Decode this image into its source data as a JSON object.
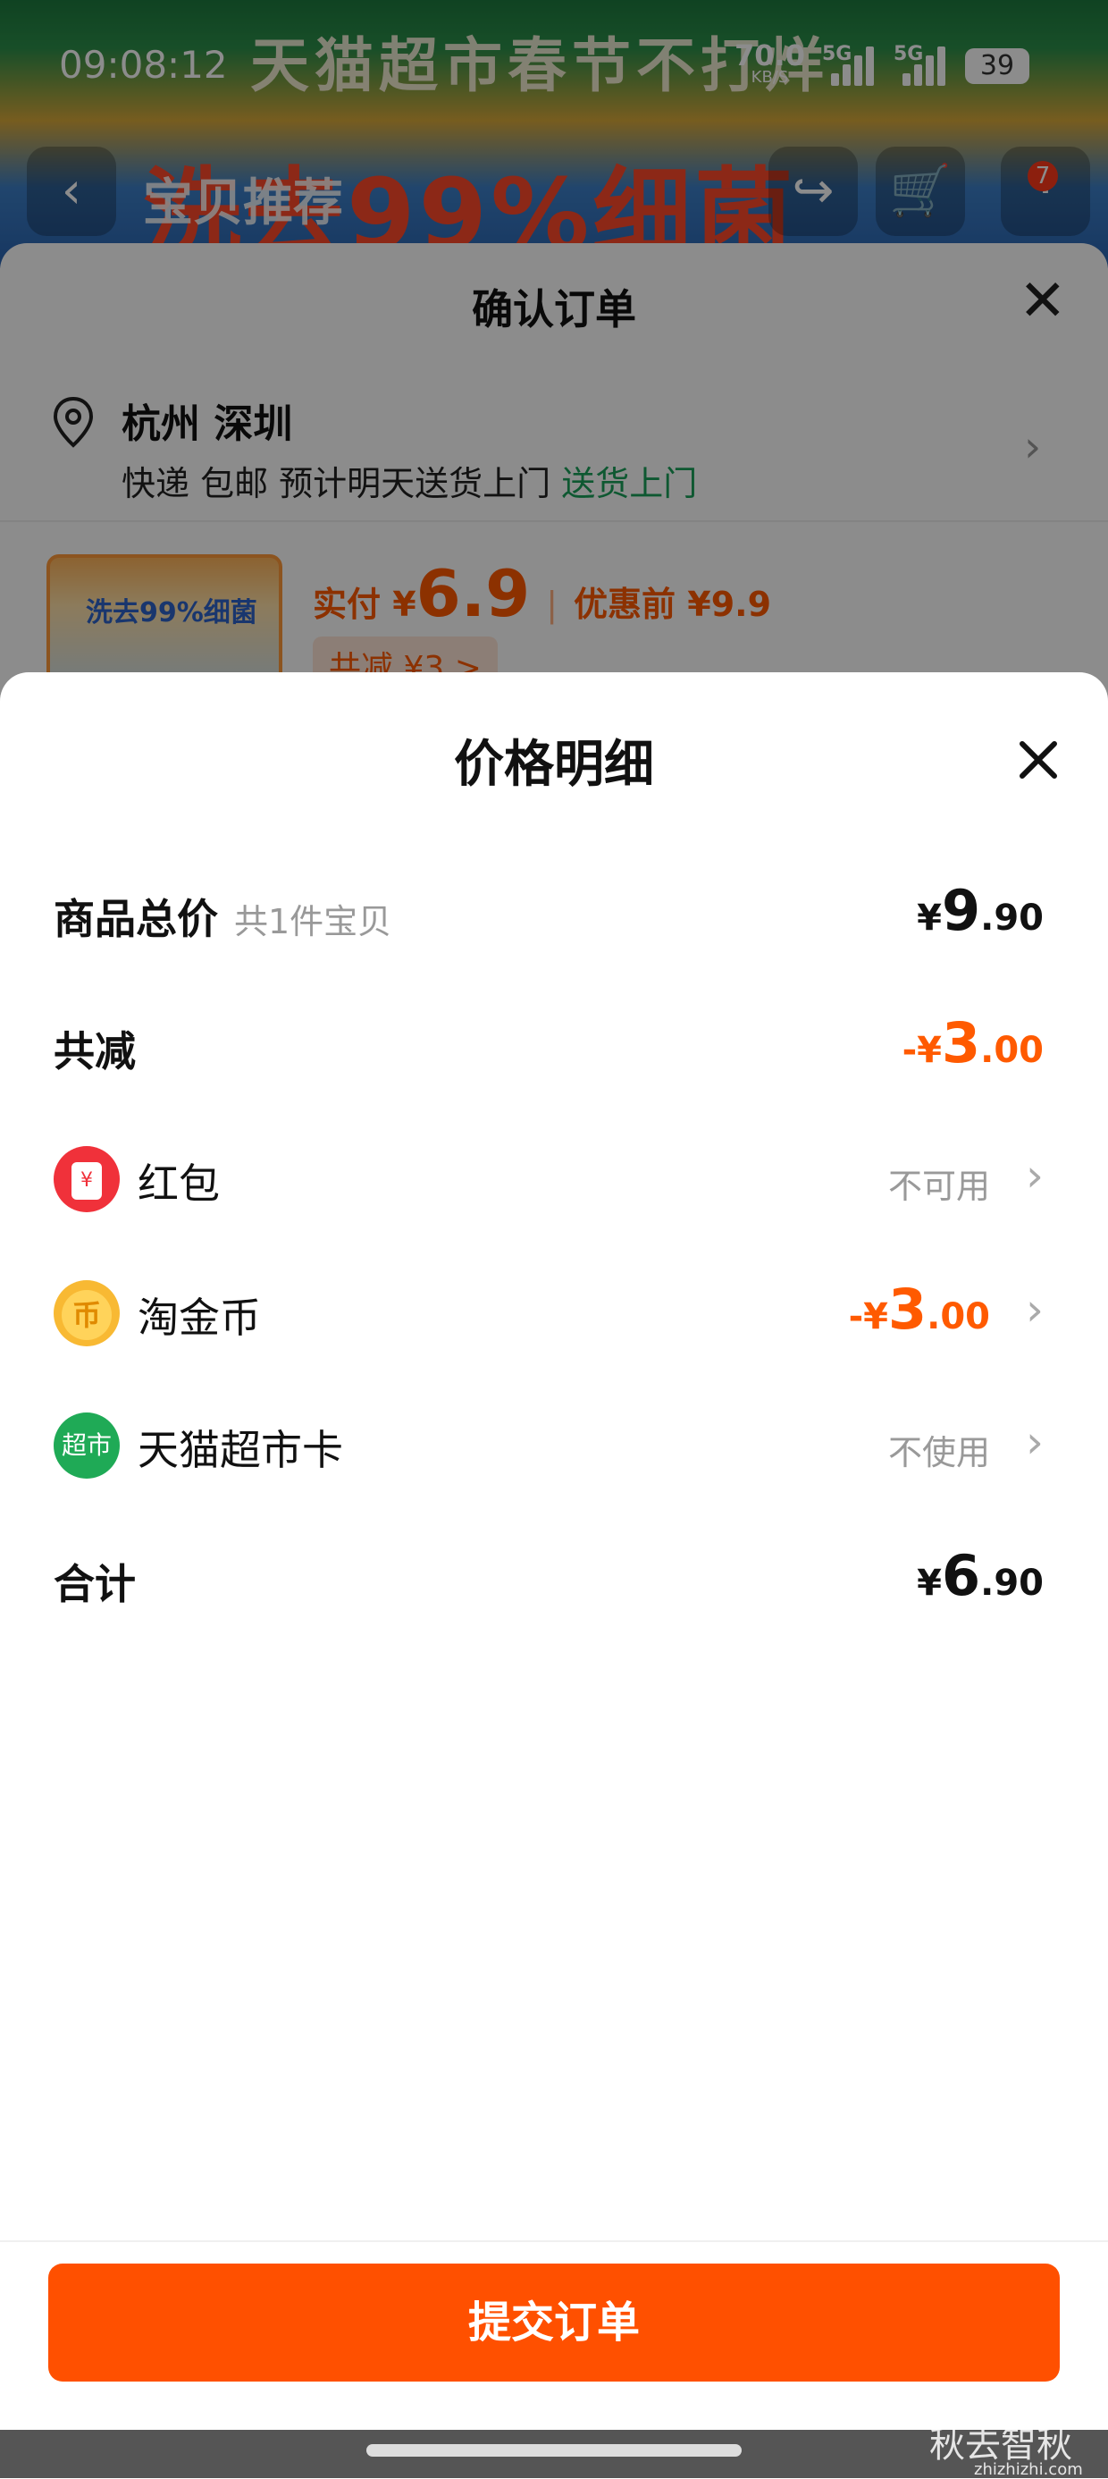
{
  "status_bar": {
    "time": "09:08:12",
    "speed_value": "70.0",
    "speed_unit": "KB/S",
    "network_1": "5G",
    "network_2": "5G",
    "battery": "39"
  },
  "background_page": {
    "banner_top": "天猫超市春节不打烊",
    "banner_slogan": "洗去99%细菌",
    "nav_title": "宝贝推荐",
    "cart_badge": "7"
  },
  "order_sheet": {
    "title": "确认订单",
    "address_main": "杭州 深圳",
    "address_sub": "快递 包邮 预计明天送货上门",
    "address_tag": "送货上门",
    "product_image_text": "洗去99%细菌",
    "price_prefix": "实付 ¥",
    "price_value": "6.9",
    "price_before_label": "优惠前 ¥9.9",
    "saving_label": "共减 ¥3 >"
  },
  "price_detail": {
    "title": "价格明细",
    "rows": {
      "goods_total": {
        "label": "商品总价",
        "note": "共1件宝贝",
        "currency": "¥",
        "int": "9",
        "dec": ".90"
      },
      "total_reduction": {
        "label": "共减",
        "currency": "-¥",
        "int": "3",
        "dec": ".00"
      },
      "red_packet": {
        "label": "红包",
        "status": "不可用",
        "icon": "red-packet-icon"
      },
      "taojin_coin": {
        "label": "淘金币",
        "currency": "-¥",
        "int": "3",
        "dec": ".00",
        "icon": "coin-icon"
      },
      "tmall_card": {
        "label": "天猫超市卡",
        "status": "不使用",
        "icon": "tmall-supermarket-icon",
        "icon_text": "超市"
      },
      "sum": {
        "label": "合计",
        "currency": "¥",
        "int": "6",
        "dec": ".90"
      }
    }
  },
  "submit_button": "提交订单",
  "watermark": {
    "text": "秋去智秋",
    "url": "zhizhizhi.com"
  },
  "colors": {
    "accent": "#ff5000",
    "reduction": "#ff5a00",
    "green_tag": "#1aa05a"
  }
}
